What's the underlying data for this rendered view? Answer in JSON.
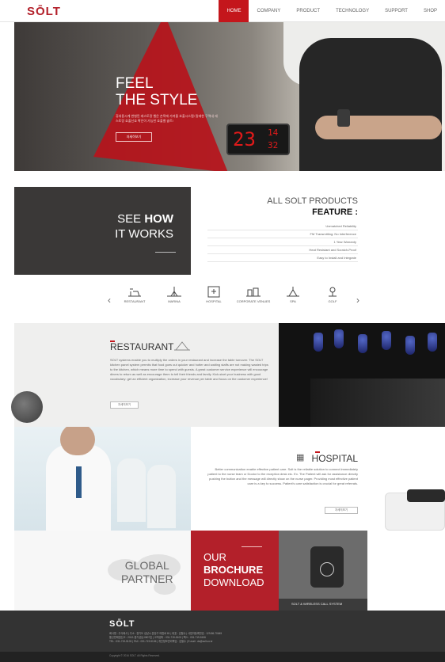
{
  "header": {
    "logo": "SŌLT",
    "nav": [
      "HOME",
      "COMPANY",
      "PRODUCT",
      "TECHNOLOGY",
      "SUPPORT",
      "SHOP"
    ],
    "active": "HOME"
  },
  "hero": {
    "title_line1": "FEEL",
    "title_line2": "THE STYLE",
    "desc": "휴대용시계 변형된 레스토랑 벨은 손목에 가져올 호출시스템! 말레한 구역내 레스토랑 호출신호 확인이 가능한 호출벨 솔트!",
    "button": "자세히보기",
    "clock_big": "23",
    "clock_small_top": "14",
    "clock_small_bottom": "32"
  },
  "how": {
    "line1_pre": "SEE ",
    "line1_bold": "HOW",
    "line2": "IT WORKS"
  },
  "features": {
    "title": "ALL SOLT PRODUCTS",
    "subtitle": "FEATURE :",
    "items": [
      "Unmatched Reliability",
      "FM Transmitting: No Interference",
      "1 Year Warranty",
      "Heat Resistant and Scratch-Proof",
      "Easy to Install and Integrate"
    ]
  },
  "icons": {
    "prev": "‹",
    "next": "›",
    "items": [
      {
        "label": "RESTAURANT",
        "icon": "restaurant-icon"
      },
      {
        "label": "MARINA",
        "icon": "marina-icon"
      },
      {
        "label": "HOSPITAL",
        "icon": "hospital-icon"
      },
      {
        "label": "CORPORATE VENUES",
        "icon": "corporate-icon"
      },
      {
        "label": "SPA",
        "icon": "spa-icon"
      },
      {
        "label": "GOLF",
        "icon": "golf-icon"
      }
    ]
  },
  "restaurant": {
    "title": "RESTAURANT",
    "text": "SOLT systems enable you to multiply the orders in your restaurant and increase the table turnover. The SOLT kitchen panel system permits that food goes out quicker and hotter and waiting staffs are not making wasted trips to the kitchen, which means more time to spend with guests. A great customer service experience will encourage diners to return as well as encourage them to tell their friends and family. Kick-start your business with good vocabulary: get an efficient organization, increase your revenue per table and focus on the customer experience!",
    "button": "자세히보기"
  },
  "hospital": {
    "title": "HOSPITAL",
    "text": "Better communication enable effective patient care. Solt is the reliable solution to connect immediately patient to the nurse team or Doctor to the reception desk etc. Ex. The Patient will ask for assistance directly pushing the button and the message will directly show on the nurse pager. Providing most effective patient care is a key to success. Patient's care satisfaction is crucial for great referrals.",
    "button": "자세히보기"
  },
  "tiles": {
    "global_line1": "GLOBAL",
    "global_line2": "PARTNER",
    "brochure_line1": "OUR",
    "brochure_line2": "BROCHURE",
    "brochure_line3": "DOWNLOAD",
    "wcs_label": "SOLT & WIRELESS CALL SYSTEM"
  },
  "footer": {
    "logo": "SŌLT",
    "addr1": "회사명 : 주식회사 | 주소 : 경기도 성남시 분당구 야탑로 81 | 대표 : 김철수 | 사업자등록번호 : 129-86-70645",
    "addr2": "통신판매업신고 : 2012-경기성남-0807호 | 고객센터 : 031-719-5103 | 팩스 : 031-719-5106",
    "addr3": "TEL : 031-719-5103 | FAX : 031-719-5106 | 개인정보관리책임 : 김철수 | E-mail : ds@solt.co.kr",
    "copyright": "Copyright © 2016 SOLT. All Rights Reserved."
  }
}
